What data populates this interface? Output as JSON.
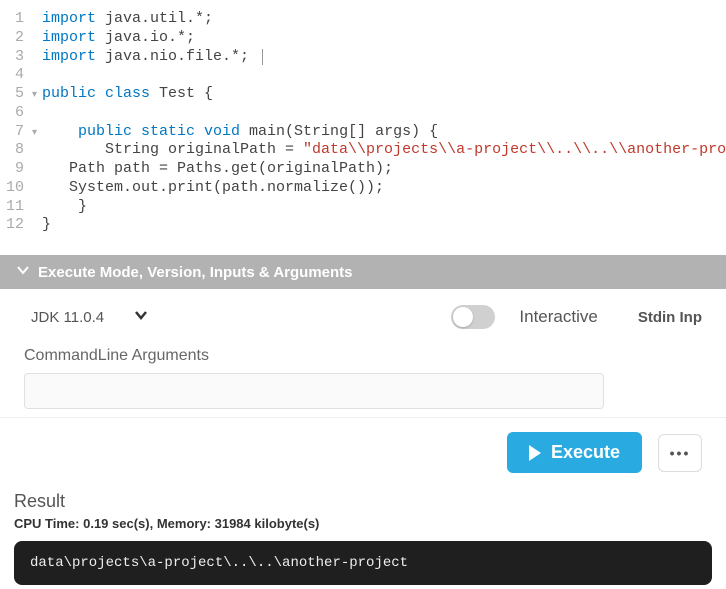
{
  "code": {
    "lines": [
      {
        "n": "1",
        "fold": "",
        "tokens": [
          {
            "c": "kw",
            "t": "import"
          },
          {
            "c": "plain",
            "t": " java.util.*;"
          }
        ]
      },
      {
        "n": "2",
        "fold": "",
        "tokens": [
          {
            "c": "kw",
            "t": "import"
          },
          {
            "c": "plain",
            "t": " java.io.*;"
          }
        ]
      },
      {
        "n": "3",
        "fold": "",
        "tokens": [
          {
            "c": "kw",
            "t": "import"
          },
          {
            "c": "plain",
            "t": " java.nio.file.*; "
          }
        ],
        "cursor": true
      },
      {
        "n": "4",
        "fold": "",
        "tokens": []
      },
      {
        "n": "5",
        "fold": "▾",
        "tokens": [
          {
            "c": "kw",
            "t": "public class"
          },
          {
            "c": "plain",
            "t": " Test {"
          }
        ]
      },
      {
        "n": "6",
        "fold": "",
        "tokens": []
      },
      {
        "n": "7",
        "fold": "▾",
        "tokens": [
          {
            "c": "plain",
            "t": "    "
          },
          {
            "c": "kw",
            "t": "public static void"
          },
          {
            "c": "plain",
            "t": " main(String[] args) {"
          }
        ]
      },
      {
        "n": "8",
        "fold": "",
        "tokens": [
          {
            "c": "plain",
            "t": "       String originalPath = "
          },
          {
            "c": "str",
            "t": "\"data\\\\projects\\\\a-project\\\\..\\\\..\\\\another-project\""
          },
          {
            "c": "plain",
            "t": ";"
          }
        ]
      },
      {
        "n": "9",
        "fold": "",
        "tokens": [
          {
            "c": "plain",
            "t": "   Path path = Paths.get(originalPath);"
          }
        ]
      },
      {
        "n": "10",
        "fold": "",
        "tokens": [
          {
            "c": "plain",
            "t": "   System.out.print(path.normalize());"
          }
        ]
      },
      {
        "n": "11",
        "fold": "",
        "tokens": [
          {
            "c": "plain",
            "t": "    }"
          }
        ]
      },
      {
        "n": "12",
        "fold": "",
        "tokens": [
          {
            "c": "plain",
            "t": "}"
          }
        ]
      }
    ]
  },
  "panel": {
    "title": "Execute Mode, Version, Inputs & Arguments"
  },
  "settings": {
    "jdk": "JDK 11.0.4",
    "interactive_label": "Interactive",
    "stdin_label": "Stdin Inp",
    "cmd_label": "CommandLine Arguments",
    "cmd_value": ""
  },
  "actions": {
    "execute": "Execute",
    "more": "•••"
  },
  "result": {
    "title": "Result",
    "meta": "CPU Time: 0.19 sec(s), Memory: 31984 kilobyte(s)",
    "output": "data\\projects\\a-project\\..\\..\\another-project"
  }
}
